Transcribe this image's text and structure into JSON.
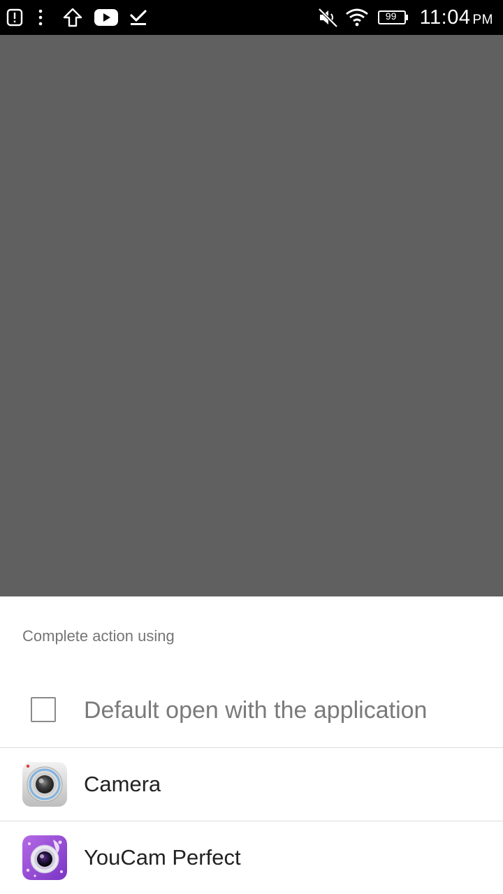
{
  "status_bar": {
    "left_icons": [
      "alert-icon",
      "more-vert-icon",
      "upload-arrow-icon",
      "youtube-icon",
      "download-done-icon"
    ],
    "right_icons": [
      "mute-icon",
      "wifi-icon",
      "battery-icon"
    ],
    "battery_level": "99",
    "time": "11:04",
    "ampm": "PM"
  },
  "chooser": {
    "title": "Complete action using",
    "default_checkbox_label": "Default open with the application",
    "default_checked": false,
    "apps": [
      {
        "label": "Camera",
        "icon": "camera-app-icon"
      },
      {
        "label": "YouCam Perfect",
        "icon": "youcam-perfect-app-icon"
      }
    ]
  },
  "colors": {
    "scrim": "#606060",
    "sheet_bg": "#ffffff",
    "title_text": "#757575",
    "checkbox_label_text": "#7a7a7a",
    "app_label_text": "#222222",
    "youcam_purple": "#9b4dd6"
  }
}
